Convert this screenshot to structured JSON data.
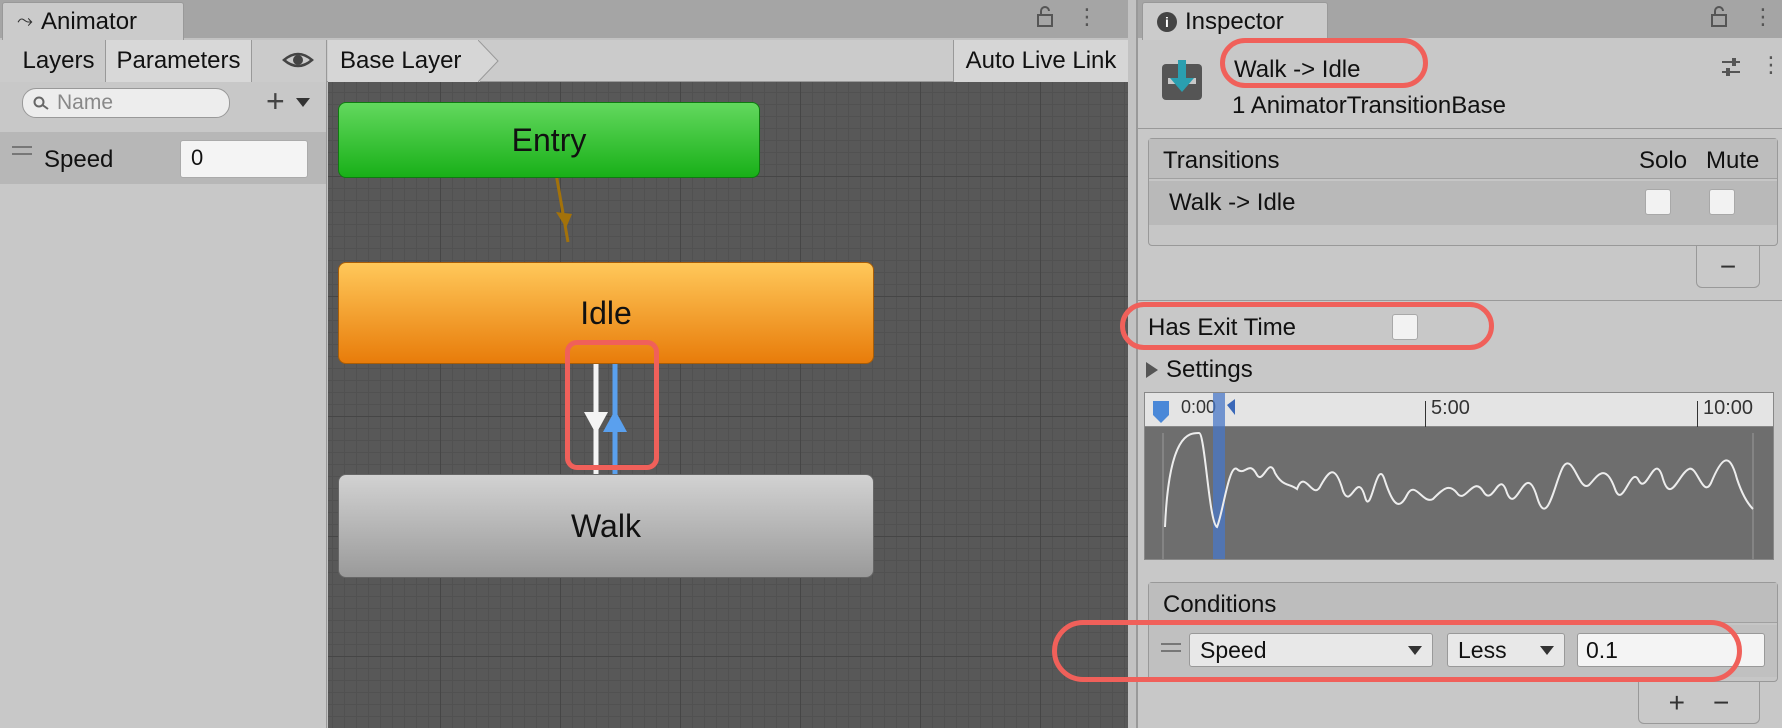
{
  "animator": {
    "tab_title": "Animator",
    "panel_tabs": [
      "Layers",
      "Parameters"
    ],
    "breadcrumb": "Base Layer",
    "auto_live_link": "Auto Live Link",
    "search_placeholder": "Name",
    "add_symbol": "+",
    "parameters": [
      {
        "name": "Speed",
        "value": "0"
      }
    ],
    "nodes": {
      "entry": "Entry",
      "idle": "Idle",
      "walk": "Walk"
    }
  },
  "inspector": {
    "tab_title": "Inspector",
    "title": "Walk ->  Idle",
    "subtitle": "1 AnimatorTransitionBase",
    "transitions": {
      "header": "Transitions",
      "solo_label": "Solo",
      "mute_label": "Mute",
      "rows": [
        {
          "label": "Walk ->  Idle",
          "solo": false,
          "mute": false
        }
      ],
      "remove_symbol": "−"
    },
    "has_exit_time": {
      "label": "Has Exit Time",
      "checked": false
    },
    "settings_label": "Settings",
    "timeline": {
      "marks": [
        "0:00",
        "5:00",
        "10:00"
      ]
    },
    "conditions": {
      "header": "Conditions",
      "parameter": "Speed",
      "mode": "Less",
      "threshold": "0.1",
      "add_symbol": "+",
      "remove_symbol": "−"
    }
  },
  "colors": {
    "highlight": "#f0605a",
    "entry_node": "#19b018",
    "idle_node": "#e87c0a",
    "walk_node": "#a8a8a8",
    "transition_selected": "#5aa0ee"
  }
}
